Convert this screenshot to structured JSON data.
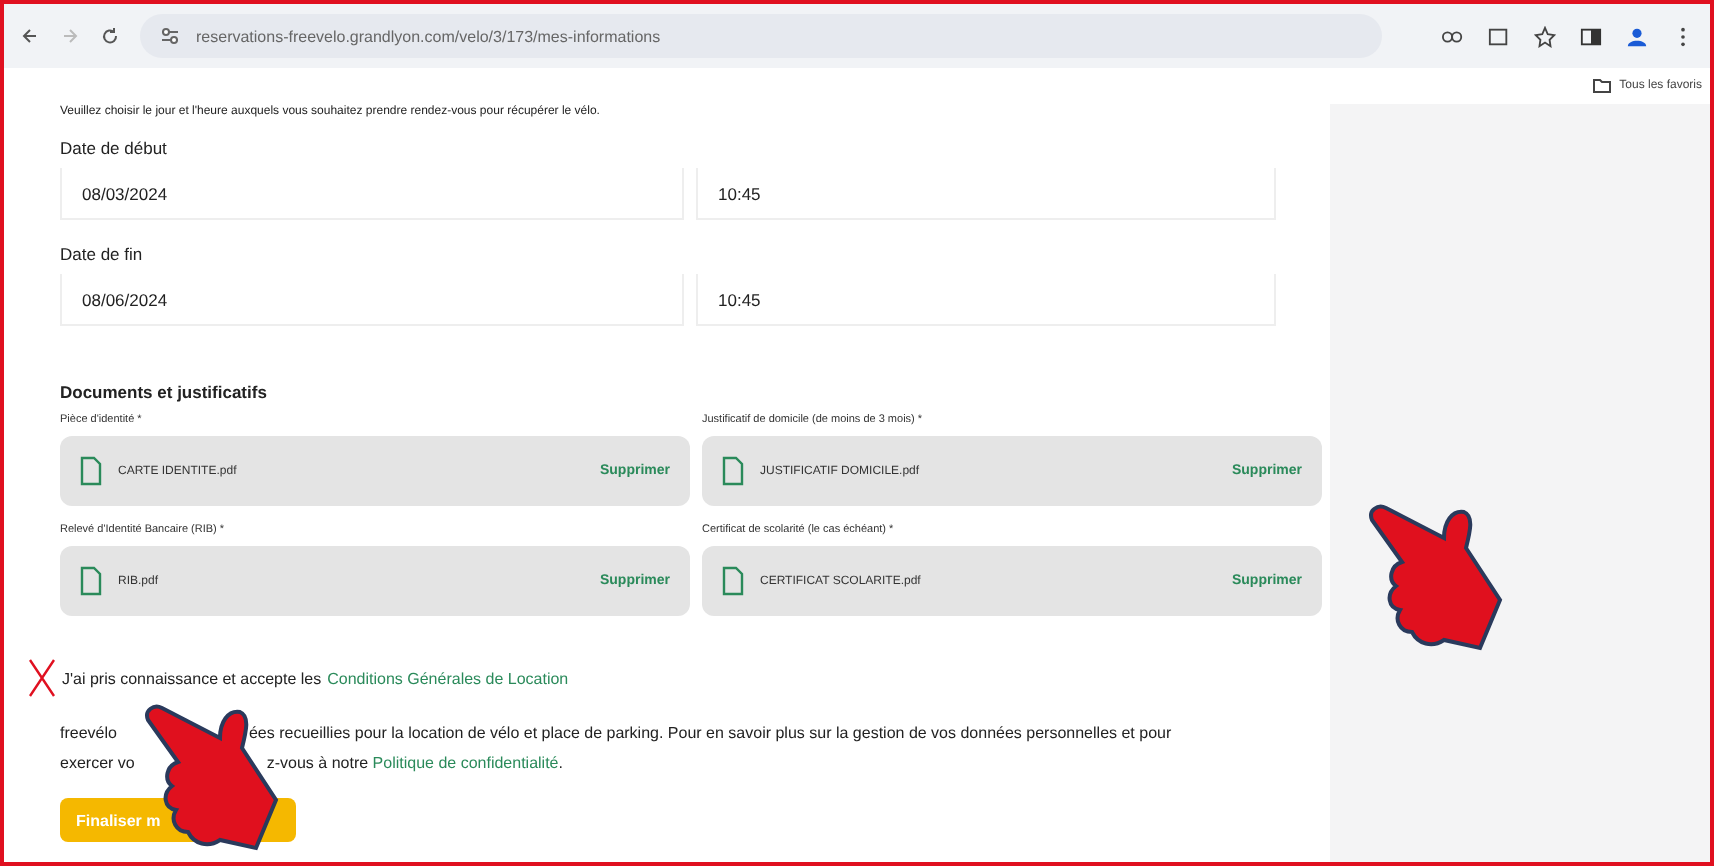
{
  "browser": {
    "url": "reservations-freevelo.grandlyon.com/velo/3/173/mes-informations",
    "bookmarks_folder": "Tous les favoris"
  },
  "intro": "Veuillez choisir le jour et l'heure auxquels vous souhaitez prendre rendez-vous pour récupérer le vélo.",
  "date_groups": [
    {
      "label": "Date de début",
      "date": "08/03/2024",
      "time": "10:45"
    },
    {
      "label": "Date de fin",
      "date": "08/06/2024",
      "time": "10:45"
    }
  ],
  "documents": {
    "title": "Documents et justificatifs",
    "items": [
      {
        "label": "Pièce d'identité *",
        "file": "CARTE IDENTITE.pdf",
        "action": "Supprimer"
      },
      {
        "label": "Justificatif de domicile (de moins de 3 mois) *",
        "file": "JUSTIFICATIF DOMICILE.pdf",
        "action": "Supprimer"
      },
      {
        "label": "Relevé d'Identité Bancaire (RIB) *",
        "file": "RIB.pdf",
        "action": "Supprimer"
      },
      {
        "label": "Certificat de scolarité (le cas échéant) *",
        "file": "CERTIFICAT SCOLARITE.pdf",
        "action": "Supprimer"
      }
    ]
  },
  "terms": {
    "text": "J'ai pris connaissance et accepte les",
    "link": "Conditions Générales de Location"
  },
  "privacy_lines": [
    {
      "before": "freevélo",
      "after": "ées recueillies pour la location de vélo et place de parking. Pour en savoir plus sur la gestion de vos données personnelles et pour"
    },
    {
      "before": "exercer vo",
      "after": "z-vous à notre",
      "link": "Politique de confidentialité",
      "end": "."
    }
  ],
  "submit": "Finaliser m"
}
